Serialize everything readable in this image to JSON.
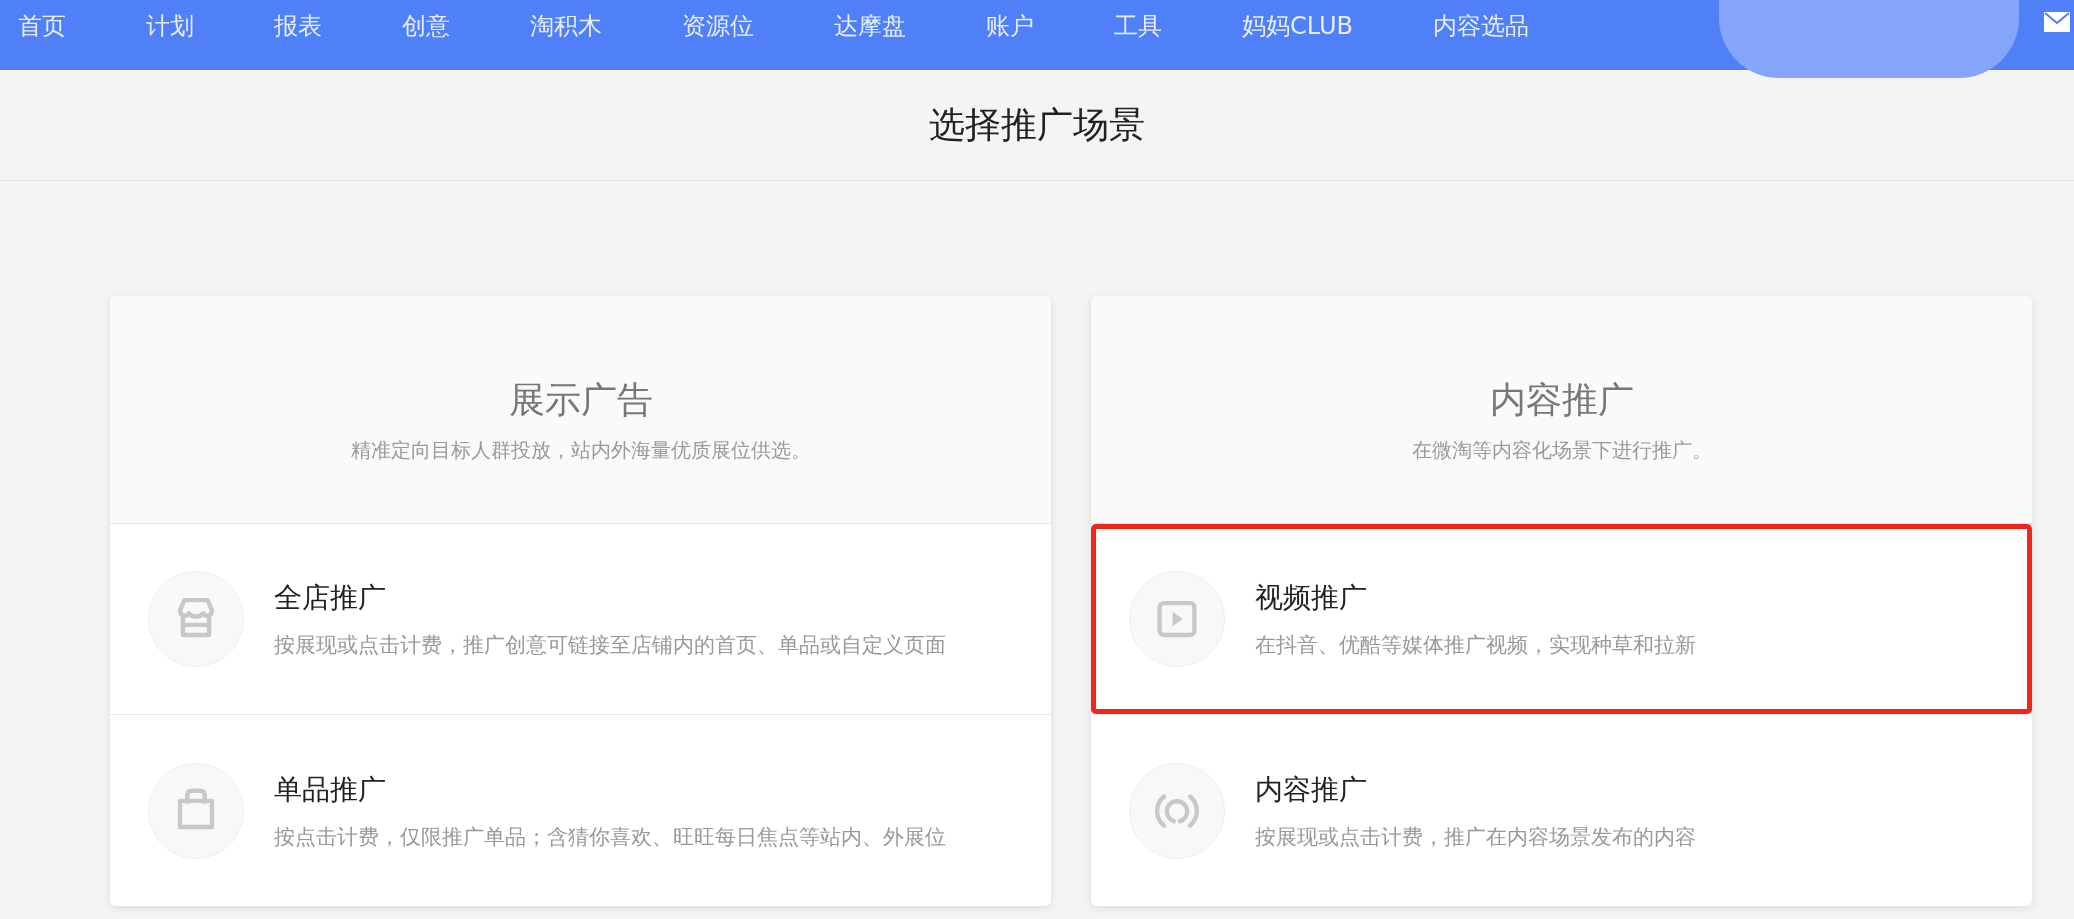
{
  "nav": {
    "items": [
      {
        "label": "首页"
      },
      {
        "label": "计划"
      },
      {
        "label": "报表"
      },
      {
        "label": "创意"
      },
      {
        "label": "淘积木"
      },
      {
        "label": "资源位"
      },
      {
        "label": "达摩盘"
      },
      {
        "label": "账户"
      },
      {
        "label": "工具"
      },
      {
        "label": "妈妈CLUB"
      },
      {
        "label": "内容选品"
      }
    ]
  },
  "page_title": "选择推广场景",
  "cards": [
    {
      "title": "展示广告",
      "subtitle": "精准定向目标人群投放，站内外海量优质展位供选。",
      "options": [
        {
          "kind": "store",
          "title": "全店推广",
          "description": "按展现或点击计费，推广创意可链接至店铺内的首页、单品或自定义页面",
          "highlighted": false
        },
        {
          "kind": "bag",
          "title": "单品推广",
          "description": "按点击计费，仅限推广单品；含猜你喜欢、旺旺每日焦点等站内、外展位",
          "highlighted": false
        }
      ]
    },
    {
      "title": "内容推广",
      "subtitle": "在微淘等内容化场景下进行推广。",
      "options": [
        {
          "kind": "video",
          "title": "视频推广",
          "description": "在抖音、优酷等媒体推广视频，实现种草和拉新",
          "highlighted": true
        },
        {
          "kind": "broadcast",
          "title": "内容推广",
          "description": "按展现或点击计费，推广在内容场景发布的内容",
          "highlighted": false
        }
      ]
    }
  ]
}
